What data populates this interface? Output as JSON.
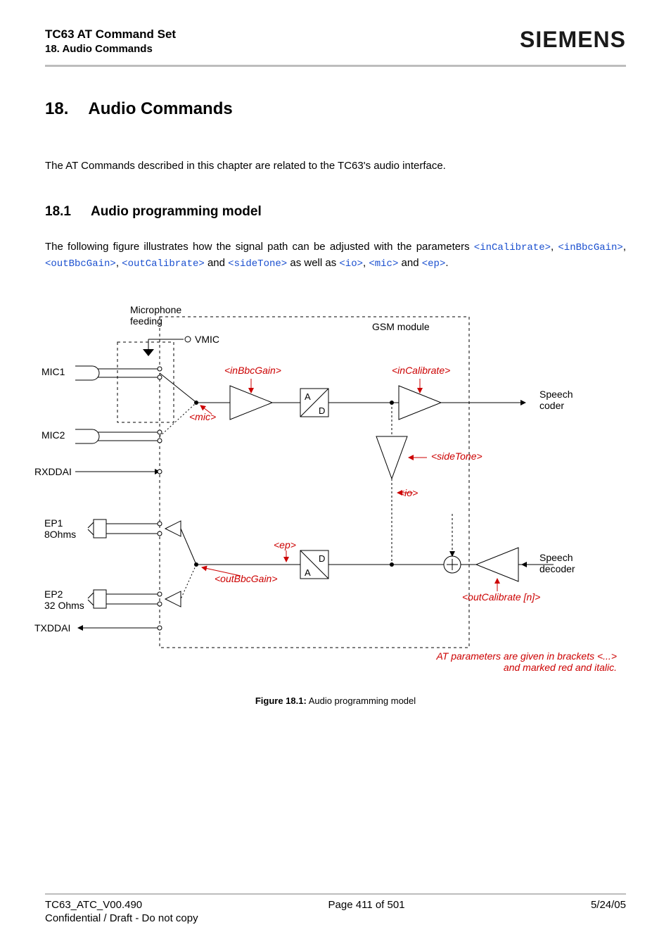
{
  "header": {
    "title": "TC63 AT Command Set",
    "subtitle": "18. Audio Commands",
    "brand": "SIEMENS"
  },
  "h1": {
    "num": "18.",
    "text": "Audio Commands"
  },
  "intro": "The AT Commands described in this chapter are related to the TC63's audio interface.",
  "h2": {
    "num": "18.1",
    "text": "Audio programming model"
  },
  "para": {
    "pre": "The following figure illustrates how the signal path can be adjusted with the parameters ",
    "p1": "<inCalibrate>",
    "c1": ", ",
    "p2": "<inBbcGain>",
    "c2": ", ",
    "p3": "<outBbcGain>",
    "c3": ", ",
    "p4": "<outCalibrate>",
    "mid": " and ",
    "p5": "<sideTone>",
    "mid2": " as well as ",
    "p6": "<io>",
    "c4": ", ",
    "p7": "<mic>",
    "mid3": " and ",
    "p8": "<ep>",
    "end": "."
  },
  "figure": {
    "micfeed": "Microphone\nfeeding",
    "vmic": "VMIC",
    "gsm": "GSM module",
    "mic1": "MIC1",
    "mic2": "MIC2",
    "rxddai": "RXDDAI",
    "ep1": "EP1\n8Ohms",
    "ep2": "EP2\n32 Ohms",
    "txddai": "TXDDAI",
    "inBbc": "<inBbcGain>",
    "inCal": "<inCalibrate>",
    "mic": "<mic>",
    "side": "<sideTone>",
    "io": "<io>",
    "ep": "<ep>",
    "outBbc": "<outBbcGain>",
    "outCal": "<outCalibrate [n]>",
    "speechc": "Speech\ncoder",
    "speechd": "Speech\ndecoder",
    "ad1_a": "A",
    "ad1_d": "D",
    "ad2_a": "A",
    "ad2_d": "D",
    "note": "AT parameters are given in brackets <...>\nand marked red and italic."
  },
  "figcaption": {
    "label": "Figure 18.1:",
    "text": " Audio programming model"
  },
  "footer": {
    "left": "TC63_ATC_V00.490",
    "center": "Page 411 of 501",
    "right": "5/24/05",
    "sub": "Confidential / Draft - Do not copy"
  }
}
